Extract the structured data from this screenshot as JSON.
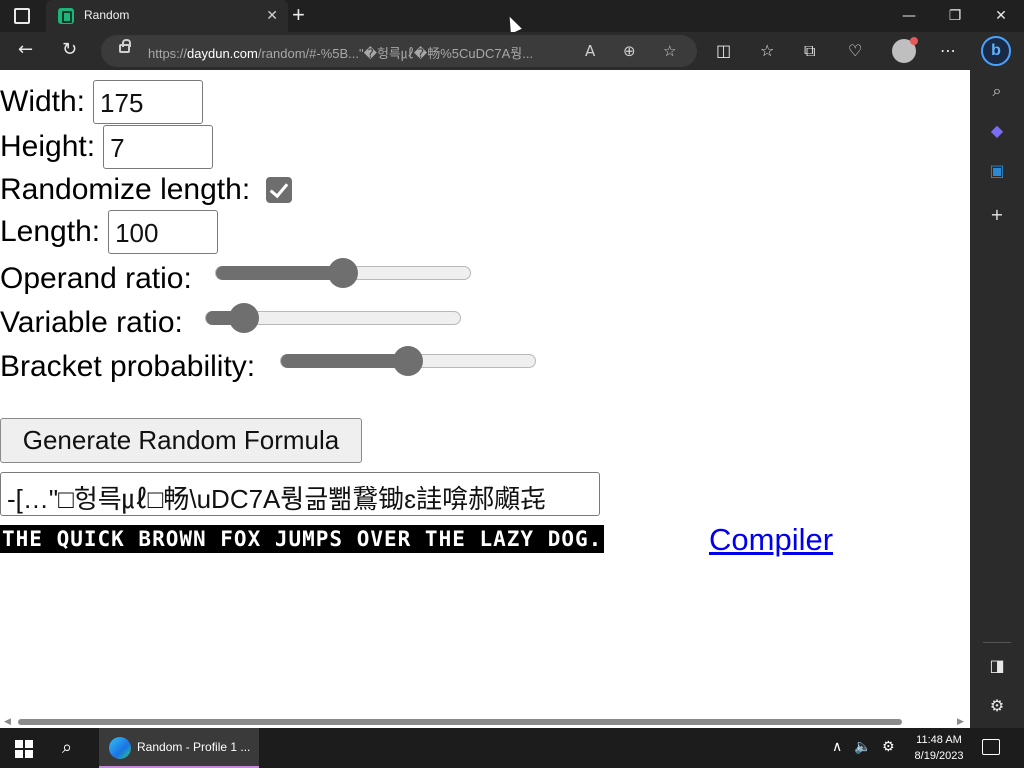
{
  "browser": {
    "tab_title": "Random",
    "tab_close": "✕",
    "new_tab": "+",
    "url_prefix": "https://",
    "url_domain": "daydun.com",
    "url_rest": "/random/#-%5B...\"�헝륵㎕�畅%5CuDC7A뤙...",
    "window_controls": {
      "minimize": "—",
      "restore": "❐",
      "close": "✕"
    }
  },
  "page": {
    "width_label": "Width:",
    "width_value": "175",
    "height_label": "Height:",
    "height_value": "7",
    "randomize_label": "Randomize length:",
    "randomize_checked": true,
    "length_label": "Length:",
    "length_value": "100",
    "operand_ratio_label": "Operand ratio:",
    "operand_ratio": 0.5,
    "variable_ratio_label": "Variable ratio:",
    "variable_ratio": 0.15,
    "bracket_probability_label": "Bracket probability:",
    "bracket_probability": 0.5,
    "generate_button": "Generate Random Formula",
    "formula_output": "-[…\"□헝륵㎕□畅\\uDC7A뤙긂뾂鵞锄ɛ詿啽郝顑㐂",
    "pangram": "THE QUICK BROWN FOX JUMPS OVER THE LAZY DOG.",
    "compiler_link": "Compiler"
  },
  "taskbar": {
    "app_label": "Random - Profile 1 ...",
    "time": "11:48 AM",
    "date": "8/19/2023"
  },
  "icons": {
    "sidebar": [
      "search-icon",
      "copilot-icon",
      "outlook-icon",
      "add-icon",
      "sidebar-toggle-icon",
      "settings-icon"
    ]
  },
  "colors": {
    "link": "#0000ee",
    "titlebar": "#202020",
    "toolbar": "#2b2b2b"
  }
}
